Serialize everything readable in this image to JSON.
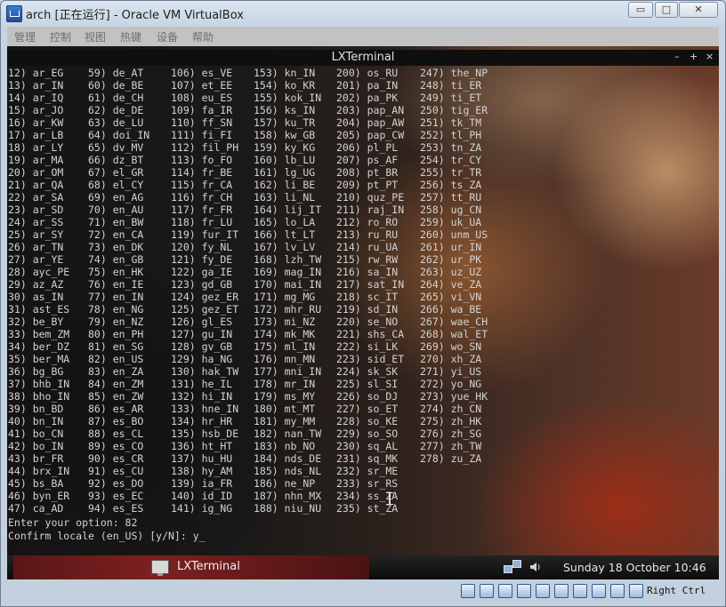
{
  "window": {
    "title": "arch [正在运行] - Oracle VM VirtualBox",
    "minimize_glyph": "▭",
    "maximize_glyph": "□",
    "close_glyph": "✕"
  },
  "menu": [
    "管理",
    "控制",
    "视图",
    "热键",
    "设备",
    "帮助"
  ],
  "terminal": {
    "title": "LXTerminal",
    "controls": [
      "–",
      "+",
      "×"
    ]
  },
  "locale_columns": [
    [
      "12) ar_EG",
      "13) ar_IN",
      "14) ar_IQ",
      "15) ar_JO",
      "16) ar_KW",
      "17) ar_LB",
      "18) ar_LY",
      "19) ar_MA",
      "20) ar_OM",
      "21) ar_QA",
      "22) ar_SA",
      "23) ar_SD",
      "24) ar_SS",
      "25) ar_SY",
      "26) ar_TN",
      "27) ar_YE",
      "28) ayc_PE",
      "29) az_AZ",
      "30) as_IN",
      "31) ast_ES",
      "32) be_BY",
      "33) bem_ZM",
      "34) ber_DZ",
      "35) ber_MA",
      "36) bg_BG",
      "37) bhb_IN",
      "38) bho_IN",
      "39) bn_BD",
      "40) bn_IN",
      "41) bo_CN",
      "42) bo_IN",
      "43) br_FR",
      "44) brx_IN",
      "45) bs_BA",
      "46) byn_ER",
      "47) ca_AD"
    ],
    [
      "59) de_AT",
      "60) de_BE",
      "61) de_CH",
      "62) de_DE",
      "63) de_LU",
      "64) doi_IN",
      "65) dv_MV",
      "66) dz_BT",
      "67) el_GR",
      "68) el_CY",
      "69) en_AG",
      "70) en_AU",
      "71) en_BW",
      "72) en_CA",
      "73) en_DK",
      "74) en_GB",
      "75) en_HK",
      "76) en_IE",
      "77) en_IN",
      "78) en_NG",
      "79) en_NZ",
      "80) en_PH",
      "81) en_SG",
      "82) en_US",
      "83) en_ZA",
      "84) en_ZM",
      "85) en_ZW",
      "86) es_AR",
      "87) es_BO",
      "88) es_CL",
      "89) es_CO",
      "90) es_CR",
      "91) es_CU",
      "92) es_DO",
      "93) es_EC",
      "94) es_ES"
    ],
    [
      "106) es_VE",
      "107) et_EE",
      "108) eu_ES",
      "109) fa_IR",
      "110) ff_SN",
      "111) fi_FI",
      "112) fil_PH",
      "113) fo_FO",
      "114) fr_BE",
      "115) fr_CA",
      "116) fr_CH",
      "117) fr_FR",
      "118) fr_LU",
      "119) fur_IT",
      "120) fy_NL",
      "121) fy_DE",
      "122) ga_IE",
      "123) gd_GB",
      "124) gez_ER",
      "125) gez_ET",
      "126) gl_ES",
      "127) gu_IN",
      "128) gv_GB",
      "129) ha_NG",
      "130) hak_TW",
      "131) he_IL",
      "132) hi_IN",
      "133) hne_IN",
      "134) hr_HR",
      "135) hsb_DE",
      "136) ht_HT",
      "137) hu_HU",
      "138) hy_AM",
      "139) ia_FR",
      "140) id_ID",
      "141) ig_NG"
    ],
    [
      "153) kn_IN",
      "154) ko_KR",
      "155) kok_IN",
      "156) ks_IN",
      "157) ku_TR",
      "158) kw_GB",
      "159) ky_KG",
      "160) lb_LU",
      "161) lg_UG",
      "162) li_BE",
      "163) li_NL",
      "164) lij_IT",
      "165) lo_LA",
      "166) lt_LT",
      "167) lv_LV",
      "168) lzh_TW",
      "169) mag_IN",
      "170) mai_IN",
      "171) mg_MG",
      "172) mhr_RU",
      "173) mi_NZ",
      "174) mk_MK",
      "175) ml_IN",
      "176) mn_MN",
      "177) mni_IN",
      "178) mr_IN",
      "179) ms_MY",
      "180) mt_MT",
      "181) my_MM",
      "182) nan_TW",
      "183) nb_NO",
      "184) nds_DE",
      "185) nds_NL",
      "186) ne_NP",
      "187) nhn_MX",
      "188) niu_NU"
    ],
    [
      "200) os_RU",
      "201) pa_IN",
      "202) pa_PK",
      "203) pap_AN",
      "204) pap_AW",
      "205) pap_CW",
      "206) pl_PL",
      "207) ps_AF",
      "208) pt_BR",
      "209) pt_PT",
      "210) quz_PE",
      "211) raj_IN",
      "212) ro_RO",
      "213) ru_RU",
      "214) ru_UA",
      "215) rw_RW",
      "216) sa_IN",
      "217) sat_IN",
      "218) sc_IT",
      "219) sd_IN",
      "220) se_NO",
      "221) shs_CA",
      "222) si_LK",
      "223) sid_ET",
      "224) sk_SK",
      "225) sl_SI",
      "226) so_DJ",
      "227) so_ET",
      "228) so_KE",
      "229) so_SO",
      "230) sq_AL",
      "231) sq_MK",
      "232) sr_ME",
      "233) sr_RS",
      "234) ss_ZA",
      "235) st_ZA"
    ],
    [
      "247) the_NP",
      "248) ti_ER",
      "249) ti_ET",
      "250) tig_ER",
      "251) tk_TM",
      "252) tl_PH",
      "253) tn_ZA",
      "254) tr_CY",
      "255) tr_TR",
      "256) ts_ZA",
      "257) tt_RU",
      "258) ug_CN",
      "259) uk_UA",
      "260) unm_US",
      "261) ur_IN",
      "262) ur_PK",
      "263) uz_UZ",
      "264) ve_ZA",
      "265) vi_VN",
      "266) wa_BE",
      "267) wae_CH",
      "268) wal_ET",
      "269) wo_SN",
      "270) xh_ZA",
      "271) yi_US",
      "272) yo_NG",
      "273) yue_HK",
      "274) zh_CN",
      "275) zh_HK",
      "276) zh_SG",
      "277) zh_TW",
      "278) zu_ZA"
    ]
  ],
  "prompt": {
    "option_line": "Enter your option: 82",
    "confirm_line": "Confirm locale (en_US) [y/N]: y_"
  },
  "panel": {
    "task_label": "LXTerminal",
    "clock": "Sunday 18 October 10:46"
  },
  "statusbar": {
    "icons": [
      "hard-disk-icon",
      "optical-drive-icon",
      "usb-icon",
      "pencil-icon",
      "shared-folder-icon",
      "display-icon",
      "network-icon",
      "audio-icon",
      "mouse-integration-icon",
      "capture-icon"
    ],
    "host_key": "Right Ctrl"
  }
}
